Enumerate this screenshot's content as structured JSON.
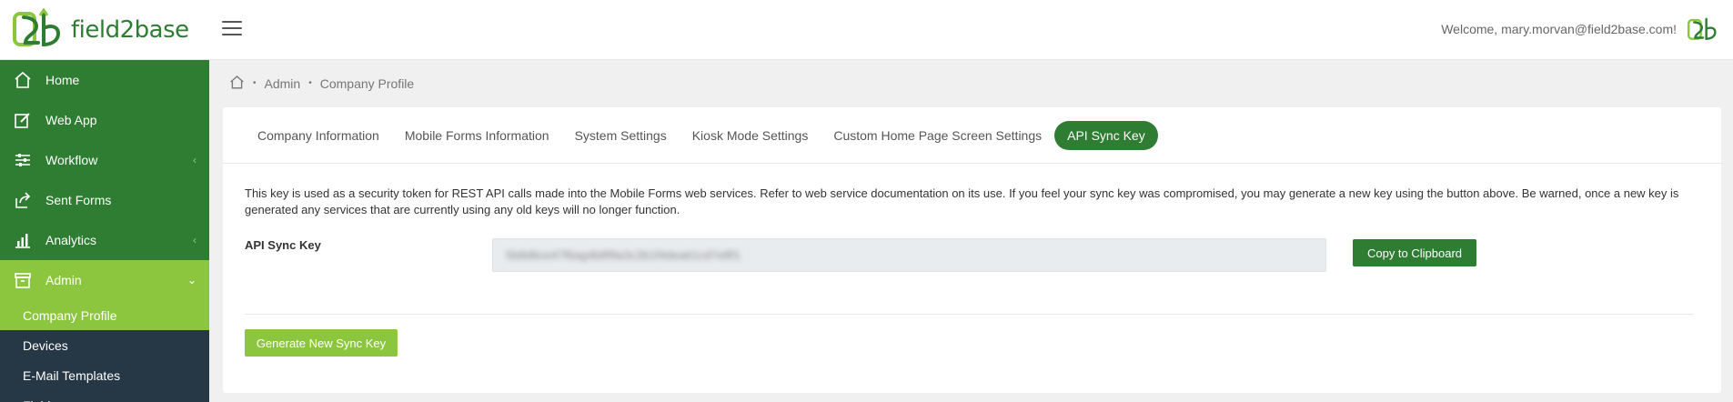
{
  "app": {
    "brand": "field2base",
    "welcome": "Welcome, mary.morvan@field2base.com!"
  },
  "colors": {
    "primary": "#2e7d32",
    "accent": "#8cc63f",
    "submenu": "#263746"
  },
  "sidebar": {
    "items": [
      {
        "label": "Home",
        "icon": "home-icon"
      },
      {
        "label": "Web App",
        "icon": "edit-icon"
      },
      {
        "label": "Workflow",
        "icon": "workflow-icon"
      },
      {
        "label": "Sent Forms",
        "icon": "share-icon"
      },
      {
        "label": "Analytics",
        "icon": "bar-chart-icon"
      },
      {
        "label": "Admin",
        "icon": "archive-icon"
      }
    ],
    "submenu": [
      {
        "label": "Company Profile"
      },
      {
        "label": "Devices"
      },
      {
        "label": "E-Mail Templates"
      },
      {
        "label": "Fields"
      }
    ]
  },
  "breadcrumb": {
    "items": [
      "Admin",
      "Company Profile"
    ]
  },
  "tabs": [
    {
      "label": "Company Information"
    },
    {
      "label": "Mobile Forms Information"
    },
    {
      "label": "System Settings"
    },
    {
      "label": "Kiosk Mode Settings"
    },
    {
      "label": "Custom Home Page Screen Settings"
    },
    {
      "label": "API Sync Key"
    }
  ],
  "content": {
    "description": "This key is used as a security token for REST API calls made into the Mobile Forms web services. Refer to web service documentation on its use. If you feel your sync key was compromised, you may generate a new key using the button above. Be warned, once a new key is generated any services that are currently using any old keys will no longer function.",
    "key_label": "API Sync Key",
    "key_value": "5b8d6ce47f6ag4b8f9a3c2b1f4dea61cd7e8f1",
    "copy_label": "Copy to Clipboard",
    "generate_label": "Generate New Sync Key"
  }
}
